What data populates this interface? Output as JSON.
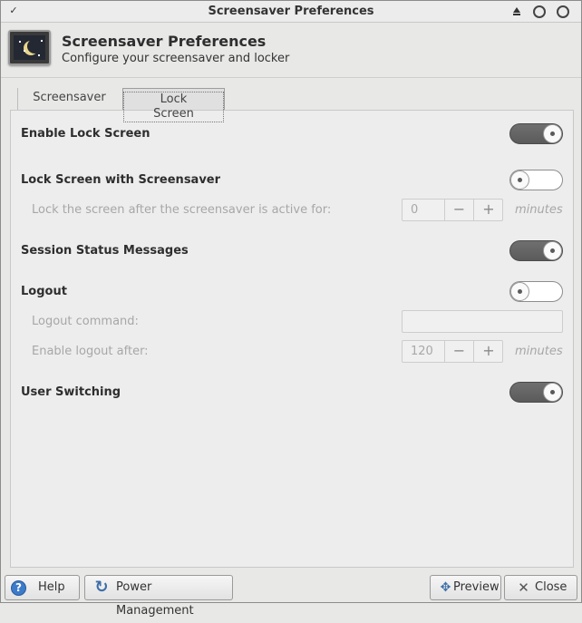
{
  "window": {
    "title": "Screensaver Preferences",
    "menu_glyph": "✓"
  },
  "header": {
    "title": "Screensaver Preferences",
    "subtitle": "Configure your screensaver and locker"
  },
  "tabs": [
    {
      "label": "Screensaver",
      "active": false
    },
    {
      "label": "Lock Screen",
      "active": true
    }
  ],
  "lock_screen": {
    "enable_lock_screen": {
      "label": "Enable Lock Screen",
      "on": true
    },
    "lock_with_screensaver": {
      "label": "Lock Screen with Screensaver",
      "on": false
    },
    "lock_after": {
      "label": "Lock the screen after the screensaver is active for:",
      "value": "0",
      "unit": "minutes",
      "minus": "−",
      "plus": "+"
    },
    "session_status": {
      "label": "Session Status Messages",
      "on": true
    },
    "logout": {
      "label": "Logout",
      "on": false
    },
    "logout_command": {
      "label": "Logout command:",
      "value": ""
    },
    "logout_after": {
      "label": "Enable logout after:",
      "value": "120",
      "unit": "minutes",
      "minus": "−",
      "plus": "+"
    },
    "user_switching": {
      "label": "User Switching",
      "on": true
    }
  },
  "buttons": {
    "help": "Help",
    "help_glyph": "?",
    "power": "Power Management",
    "power_glyph": "↻",
    "preview": "Preview",
    "preview_glyph": "✥",
    "close": "Close",
    "close_glyph": "✕"
  },
  "icons": {
    "app": "screensaver-moon-icon",
    "help": "help-icon",
    "power": "power-management-icon",
    "preview": "preview-icon",
    "close": "close-icon"
  }
}
